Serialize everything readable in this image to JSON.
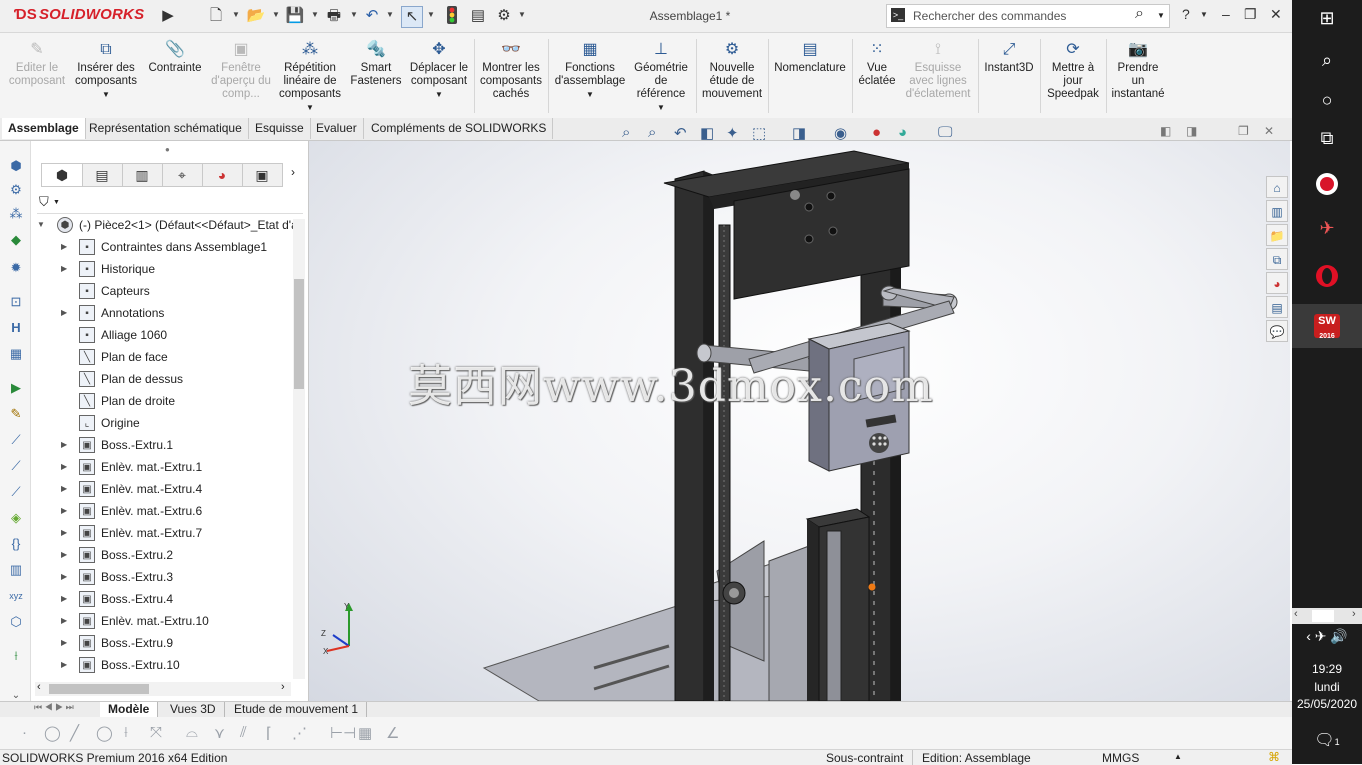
{
  "app": {
    "logo_text": "SOLIDWORKS",
    "document_title": "Assemblage1 *",
    "search_placeholder": "Rechercher des commandes"
  },
  "command_manager": [
    {
      "label": "Editer le composant",
      "icon": "edit-component-icon",
      "enabled": false
    },
    {
      "label": "Insérer des composants",
      "icon": "insert-components-icon",
      "enabled": true
    },
    {
      "label": "Contrainte",
      "icon": "mate-paperclip-icon",
      "enabled": true
    },
    {
      "label": "Fenêtre d'aperçu du comp...",
      "icon": "preview-window-icon",
      "enabled": false
    },
    {
      "label": "Répétition linéaire de composants",
      "icon": "linear-pattern-icon",
      "enabled": true
    },
    {
      "label": "Smart Fasteners",
      "icon": "smart-fasteners-icon",
      "enabled": true
    },
    {
      "label": "Déplacer le composant",
      "icon": "move-component-icon",
      "enabled": true
    },
    {
      "label": "Montrer les composants cachés",
      "icon": "show-hidden-icon",
      "enabled": true
    },
    {
      "label": "Fonctions d'assemblage",
      "icon": "assembly-features-icon",
      "enabled": true
    },
    {
      "label": "Géométrie de référence",
      "icon": "reference-geometry-icon",
      "enabled": true
    },
    {
      "label": "Nouvelle étude de mouvement",
      "icon": "motion-study-icon",
      "enabled": true
    },
    {
      "label": "Nomenclature",
      "icon": "bom-icon",
      "enabled": true
    },
    {
      "label": "Vue éclatée",
      "icon": "exploded-view-icon",
      "enabled": true
    },
    {
      "label": "Esquisse avec lignes d'éclatement",
      "icon": "explode-line-icon",
      "enabled": false
    },
    {
      "label": "Instant3D",
      "icon": "instant3d-icon",
      "enabled": true
    },
    {
      "label": "Mettre à jour Speedpak",
      "icon": "speedpak-icon",
      "enabled": true
    },
    {
      "label": "Prendre un instantané",
      "icon": "camera-icon",
      "enabled": true
    }
  ],
  "tabs": [
    {
      "label": "Assemblage",
      "active": true
    },
    {
      "label": "Représentation schématique",
      "active": false
    },
    {
      "label": "Esquisse",
      "active": false
    },
    {
      "label": "Evaluer",
      "active": false
    },
    {
      "label": "Compléments de SOLIDWORKS",
      "active": false
    }
  ],
  "tree": {
    "root": "(-) Pièce2<1> (Défaut<<Défaut>_Etat d'a",
    "items": [
      {
        "label": "Contraintes dans Assemblage1",
        "expandable": true,
        "icon": "mates-folder-icon"
      },
      {
        "label": "Historique",
        "expandable": true,
        "icon": "history-icon"
      },
      {
        "label": "Capteurs",
        "expandable": false,
        "icon": "sensor-icon"
      },
      {
        "label": "Annotations",
        "expandable": true,
        "icon": "annotations-icon"
      },
      {
        "label": "Alliage 1060",
        "expandable": false,
        "icon": "material-icon"
      },
      {
        "label": "Plan de face",
        "expandable": false,
        "icon": "plane-icon"
      },
      {
        "label": "Plan de dessus",
        "expandable": false,
        "icon": "plane-icon"
      },
      {
        "label": "Plan de droite",
        "expandable": false,
        "icon": "plane-icon"
      },
      {
        "label": "Origine",
        "expandable": false,
        "icon": "origin-icon"
      },
      {
        "label": "Boss.-Extru.1",
        "expandable": true,
        "icon": "boss-extrude-icon"
      },
      {
        "label": "Enlèv. mat.-Extru.1",
        "expandable": true,
        "icon": "cut-extrude-icon"
      },
      {
        "label": "Enlèv. mat.-Extru.4",
        "expandable": true,
        "icon": "cut-extrude-icon"
      },
      {
        "label": "Enlèv. mat.-Extru.6",
        "expandable": true,
        "icon": "cut-extrude-icon"
      },
      {
        "label": "Enlèv. mat.-Extru.7",
        "expandable": true,
        "icon": "cut-extrude-icon"
      },
      {
        "label": "Boss.-Extru.2",
        "expandable": true,
        "icon": "boss-extrude-icon"
      },
      {
        "label": "Boss.-Extru.3",
        "expandable": true,
        "icon": "boss-extrude-icon"
      },
      {
        "label": "Boss.-Extru.4",
        "expandable": true,
        "icon": "boss-extrude-icon"
      },
      {
        "label": "Enlèv. mat.-Extru.10",
        "expandable": true,
        "icon": "cut-extrude-icon"
      },
      {
        "label": "Boss.-Extru.9",
        "expandable": true,
        "icon": "boss-extrude-icon"
      },
      {
        "label": "Boss.-Extru.10",
        "expandable": true,
        "icon": "boss-extrude-icon"
      }
    ]
  },
  "watermark": "莫西网www.3dmox.com",
  "bottom_tabs": [
    {
      "label": "Modèle",
      "active": true
    },
    {
      "label": "Vues 3D",
      "active": false
    },
    {
      "label": "Etude de mouvement 1",
      "active": false
    }
  ],
  "status": {
    "product": "SOLIDWORKS Premium 2016 x64 Edition",
    "constraint": "Sous-contraint",
    "mode": "Edition: Assemblage",
    "units": "MMGS"
  },
  "taskbar": {
    "time": "19:29",
    "day": "lundi",
    "date": "25/05/2020",
    "sw_badge": "2016",
    "notification_count": "1"
  },
  "colors": {
    "brand_red": "#d6212a",
    "frame_dark": "#2b2b2b",
    "sheet_gray": "#aeb0b8",
    "taskbar_bg": "#1c1c1c"
  }
}
